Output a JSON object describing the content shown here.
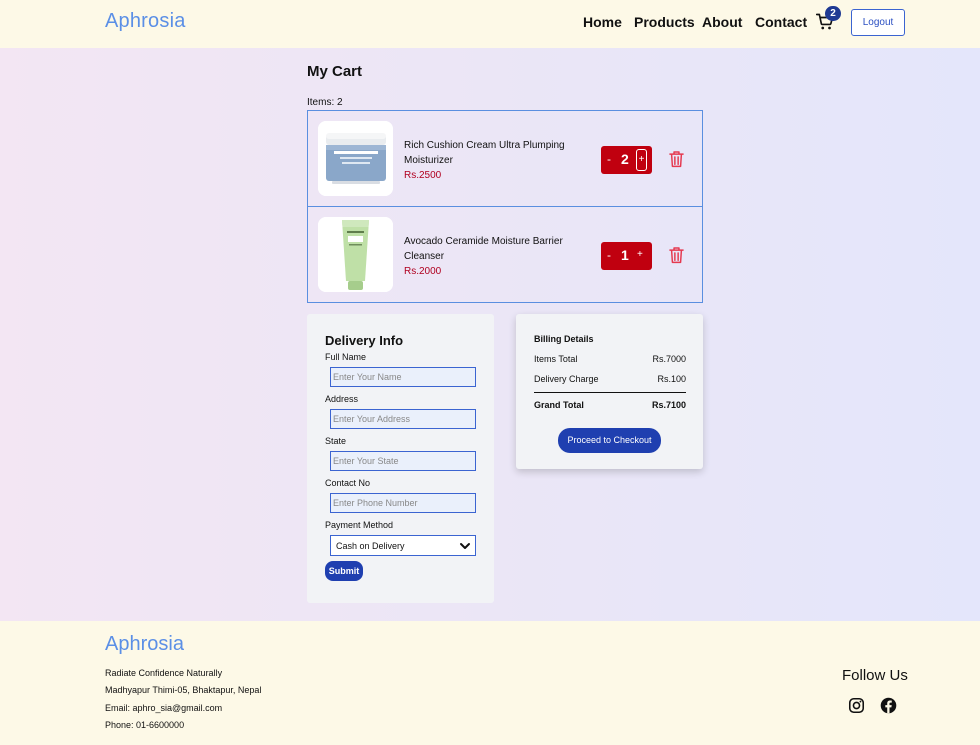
{
  "header": {
    "brand": "Aphrosia",
    "nav": [
      "Home",
      "Products",
      "About",
      "Contact"
    ],
    "cart_count": "2",
    "logout_label": "Logout"
  },
  "cart": {
    "title": "My Cart",
    "items_label": "Items: 2",
    "items": [
      {
        "name": "Rich Cushion Cream Ultra Plumping Moisturizer",
        "price": "Rs.2500",
        "quantity": "2",
        "minus": "-",
        "plus": "+"
      },
      {
        "name": "Avocado Ceramide Moisture Barrier Cleanser",
        "price": "Rs.2000",
        "quantity": "1",
        "minus": "-",
        "plus": "+"
      }
    ]
  },
  "delivery": {
    "title": "Delivery Info",
    "fields": [
      {
        "label": "Full Name",
        "placeholder": "Enter Your Name"
      },
      {
        "label": "Address",
        "placeholder": "Enter Your Address"
      },
      {
        "label": "State",
        "placeholder": "Enter Your State"
      },
      {
        "label": "Contact No",
        "placeholder": "Enter Phone Number"
      }
    ],
    "payment_label": "Payment Method",
    "payment_selected": "Cash on Delivery",
    "submit_label": "Submit"
  },
  "billing": {
    "title": "Billing Details",
    "items_total_label": "Items Total",
    "items_total": "Rs.7000",
    "delivery_label": "Delivery Charge",
    "delivery_charge": "Rs.100",
    "grand_label": "Grand Total",
    "grand_total": "Rs.7100",
    "checkout_label": "Proceed to Checkout"
  },
  "footer": {
    "brand": "Aphrosia",
    "tagline": "Radiate Confidence Naturally",
    "address": "Madhyapur Thimi-05, Bhaktapur, Nepal",
    "email": "Email: aphro_sia@gmail.com",
    "phone": "Phone: 01-6600000",
    "follow": "Follow Us"
  },
  "colors": {
    "brand": "#5b8fe6",
    "primary_button": "#1f3fb0",
    "quantity_red": "#c0000f",
    "header_bg": "#fdf9e7"
  },
  "icons": [
    "cart-icon",
    "trash-icon",
    "instagram-icon",
    "facebook-icon",
    "chevron-down-icon"
  ]
}
